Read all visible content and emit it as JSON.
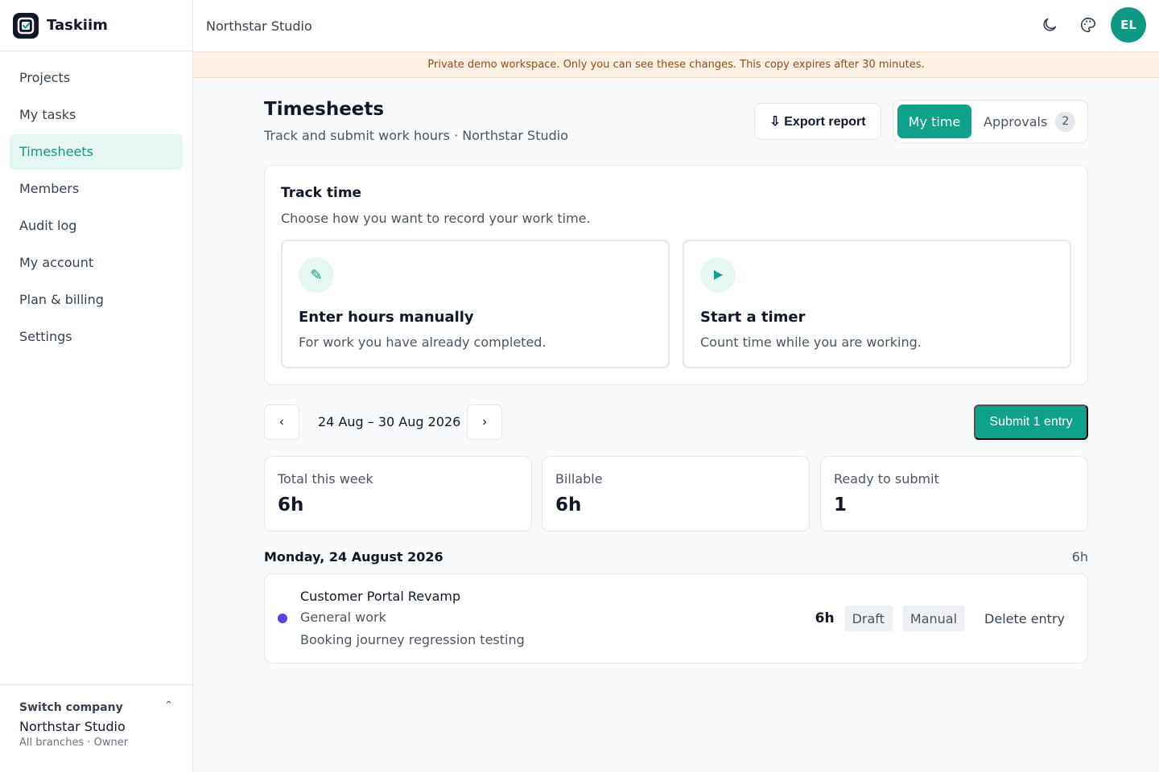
{
  "app": {
    "name": "Taskiim"
  },
  "sidebar": {
    "items": [
      {
        "label": "Projects"
      },
      {
        "label": "My tasks"
      },
      {
        "label": "Timesheets"
      },
      {
        "label": "Members"
      },
      {
        "label": "Audit log"
      },
      {
        "label": "My account"
      },
      {
        "label": "Plan & billing"
      },
      {
        "label": "Settings"
      }
    ],
    "active_index": 2,
    "switch_company": {
      "label": "Switch company",
      "name": "Northstar Studio",
      "sub": "All branches · Owner"
    }
  },
  "topbar": {
    "workspace": "Northstar Studio",
    "avatar_initials": "EL"
  },
  "banner": {
    "text": "Private demo workspace.  Only you can see these changes. This copy expires after 30 minutes."
  },
  "page": {
    "title": "Timesheets",
    "subtitle": "Track and submit work hours · Northstar Studio",
    "export_label": "⇩ Export report",
    "tabs": {
      "my_time": "My time",
      "approvals": "Approvals",
      "approvals_count": "2"
    }
  },
  "track": {
    "title": "Track time",
    "subtitle": "Choose how you want to record your work time.",
    "manual": {
      "title": "Enter hours manually",
      "sub": "For work you have already completed."
    },
    "timer": {
      "title": "Start a timer",
      "sub": "Count time while you are working."
    }
  },
  "week": {
    "prev": "‹",
    "next": "›",
    "range": "24 Aug – 30 Aug 2026",
    "submit_label": "Submit 1 entry"
  },
  "stats": [
    {
      "label": "Total this week",
      "value": "6h"
    },
    {
      "label": "Billable",
      "value": "6h"
    },
    {
      "label": "Ready to submit",
      "value": "1"
    }
  ],
  "day": {
    "title": "Monday, 24 August 2026",
    "total": "6h",
    "entries": [
      {
        "project": "Customer Portal Revamp",
        "category": "General work",
        "description": "Booking journey regression testing",
        "hours": "6h",
        "status": "Draft",
        "source": "Manual",
        "delete_label": "Delete entry",
        "dot_color": "#4f46e5"
      }
    ]
  },
  "colors": {
    "accent": "#10a18a",
    "banner_bg": "#fcf1e4",
    "banner_text": "#9a4a12"
  }
}
